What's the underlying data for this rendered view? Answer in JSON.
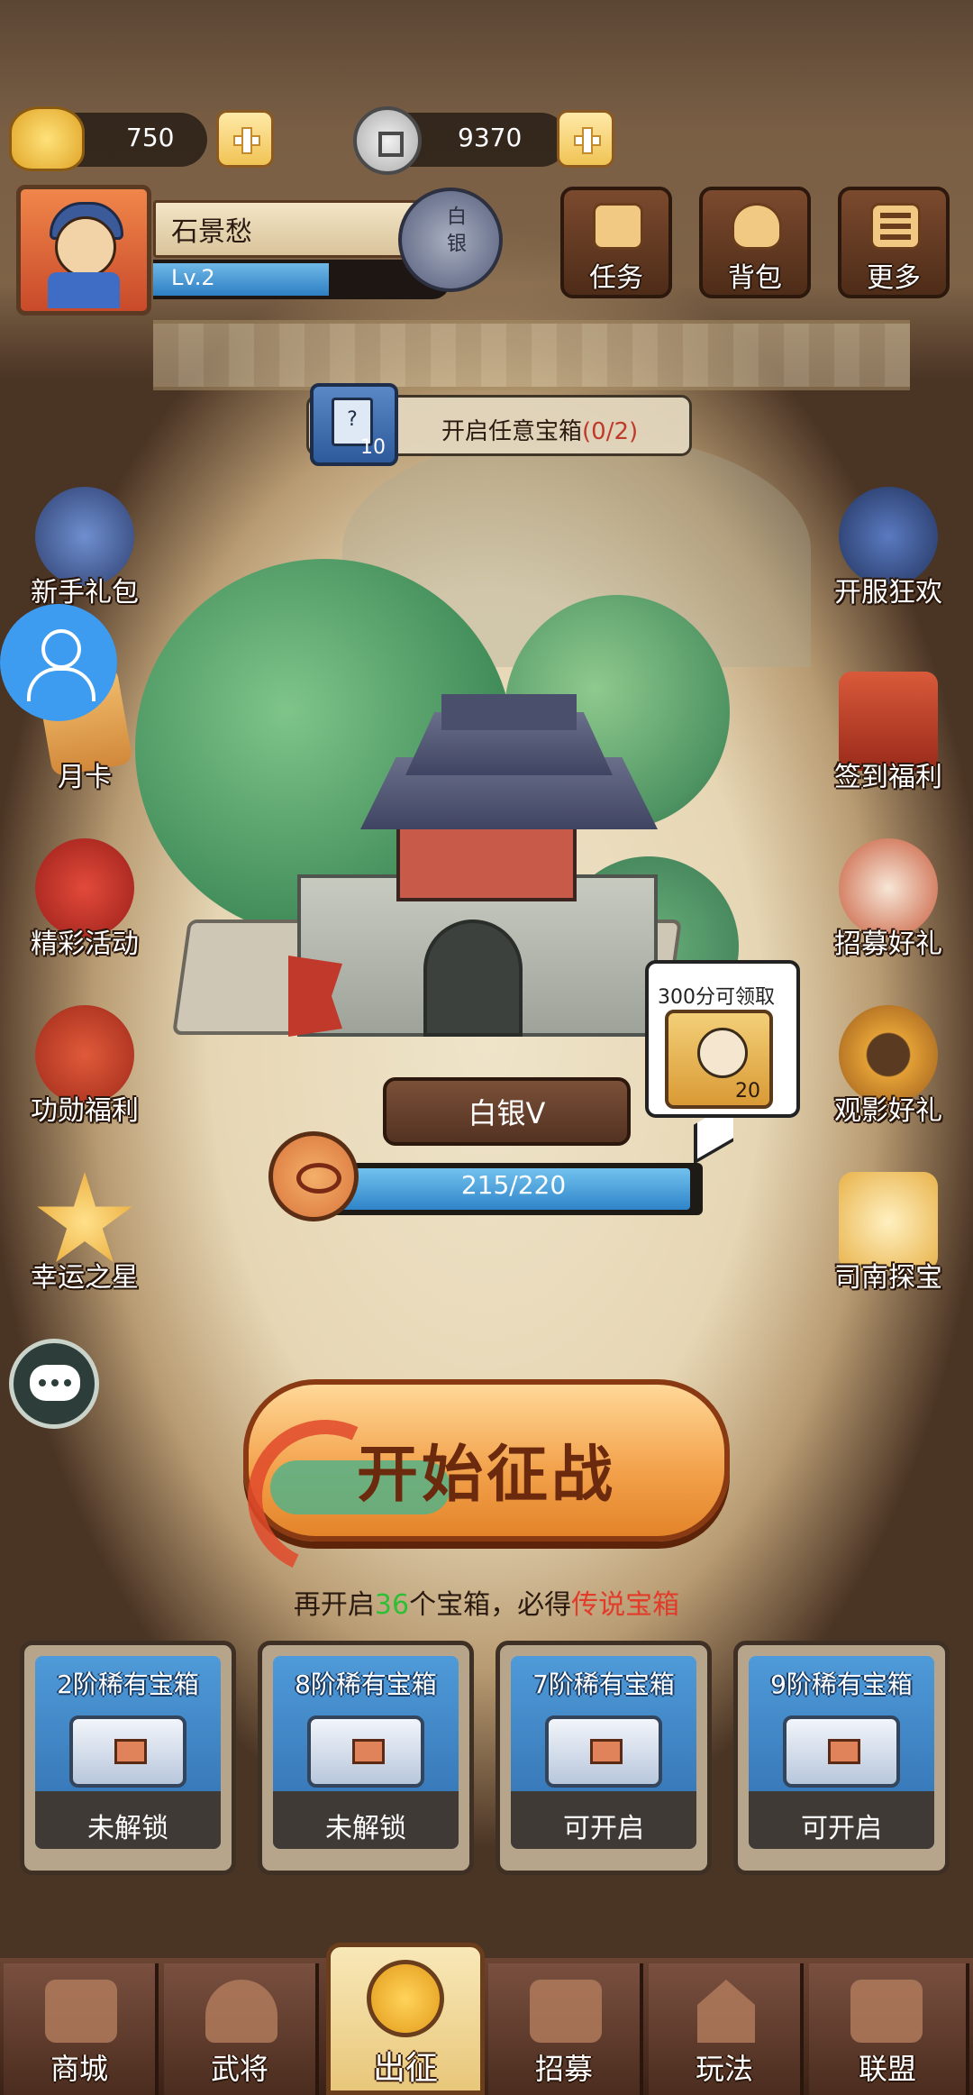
{
  "currency": {
    "gold": {
      "icon": "gold-ingot-icon",
      "value": "750"
    },
    "coin": {
      "icon": "copper-coin-icon",
      "value": "9370"
    }
  },
  "profile": {
    "name": "石景愁",
    "level": "Lv.2",
    "level_progress": 0.6,
    "rank_badge": "白银"
  },
  "top_buttons": [
    {
      "label": "任务",
      "icon": "scroll-icon"
    },
    {
      "label": "背包",
      "icon": "bag-icon"
    },
    {
      "label": "更多",
      "icon": "menu-icon"
    }
  ],
  "task": {
    "icon_badge": "?",
    "count": "10",
    "text": "开启任意宝箱",
    "progress": "(0/2)"
  },
  "left_menu": [
    {
      "label": "新手礼包",
      "icon": "hero-gift-icon"
    },
    {
      "label": "月卡",
      "icon": "month-card-icon"
    },
    {
      "label": "精彩活动",
      "icon": "event-bag-icon"
    },
    {
      "label": "功勋福利",
      "icon": "merit-pouch-icon"
    },
    {
      "label": "幸运之星",
      "icon": "lucky-star-icon"
    }
  ],
  "right_menu": [
    {
      "label": "开服狂欢",
      "icon": "carnival-hero-icon"
    },
    {
      "label": "签到福利",
      "icon": "sign-in-icon"
    },
    {
      "label": "招募好礼",
      "icon": "drum-icon"
    },
    {
      "label": "观影好礼",
      "icon": "film-reel-icon"
    },
    {
      "label": "司南探宝",
      "icon": "compass-icon"
    }
  ],
  "reward": {
    "text": "300分可领取",
    "count": "20"
  },
  "rank": {
    "title": "白银Ⅴ",
    "progress_text": "215/220",
    "progress": 0.977
  },
  "battle_button": "开始征战",
  "hint": {
    "prefix": "再开启",
    "number": "36",
    "middle": "个宝箱，必得",
    "legend": "传说宝箱"
  },
  "chests": [
    {
      "title": "2阶稀有宝箱",
      "state": "未解锁"
    },
    {
      "title": "8阶稀有宝箱",
      "state": "未解锁"
    },
    {
      "title": "7阶稀有宝箱",
      "state": "可开启"
    },
    {
      "title": "9阶稀有宝箱",
      "state": "可开启"
    }
  ],
  "nav": [
    {
      "label": "商城",
      "icon": "shop-icon"
    },
    {
      "label": "武将",
      "icon": "general-icon"
    },
    {
      "label": "出征",
      "icon": "campaign-icon"
    },
    {
      "label": "招募",
      "icon": "recruit-icon"
    },
    {
      "label": "玩法",
      "icon": "gameplay-icon"
    },
    {
      "label": "联盟",
      "icon": "alliance-icon"
    }
  ],
  "colors": {
    "accent_blue": "#2e84c8",
    "legend_red": "#e23b2a",
    "hint_green": "#2fbf36",
    "battle_orange": "#f3a34d"
  }
}
